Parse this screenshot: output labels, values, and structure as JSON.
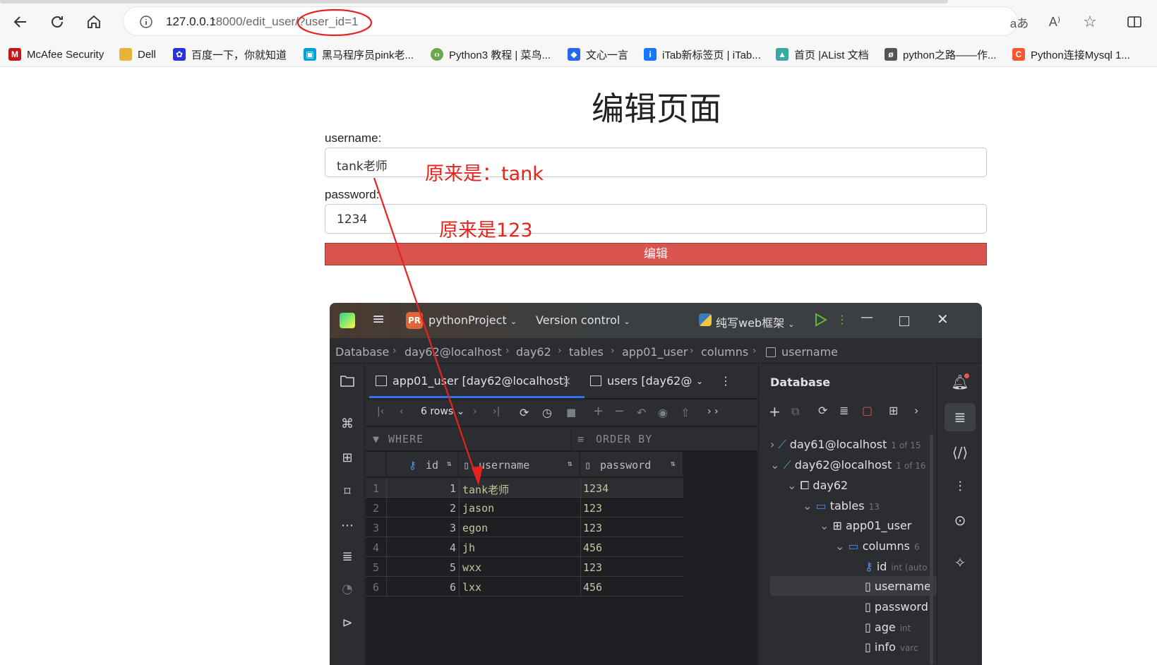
{
  "browser": {
    "url_host": "127.0.0.1",
    "url_path": ":8000/edit_user/?user_id=1",
    "bookmarks": [
      {
        "label": "McAfee Security",
        "icon": "mcafee-icon",
        "color": "#c01818"
      },
      {
        "label": "Dell",
        "icon": "folder-icon",
        "color": "#e8b339"
      },
      {
        "label": "百度一下，你就知道",
        "icon": "baidu-icon",
        "color": "#2932e1"
      },
      {
        "label": "黑马程序员pink老...",
        "icon": "bilibili-icon",
        "color": "#00a1d6"
      },
      {
        "label": "Python3 教程 | 菜鸟...",
        "icon": "runoob-icon",
        "color": "#6aa84f"
      },
      {
        "label": "文心一言",
        "icon": "wenxin-icon",
        "color": "#2468f2"
      },
      {
        "label": "iTab新标签页 | iTab...",
        "icon": "itab-icon",
        "color": "#1677ff"
      },
      {
        "label": "首页 |AList 文档",
        "icon": "alist-icon",
        "color": "#3aa7a3"
      },
      {
        "label": "python之路——作...",
        "icon": "python-road-icon",
        "color": "#555555"
      },
      {
        "label": "Python连接Mysql 1...",
        "icon": "csdn-icon",
        "color": "#fc5531"
      }
    ]
  },
  "form": {
    "title": "编辑页面",
    "username_label": "username:",
    "username_value": "tank老师",
    "password_label": "password:",
    "password_value": "1234",
    "submit_label": "编辑"
  },
  "annotations": {
    "note_username": "原来是：tank",
    "note_password": "原来是123",
    "accent_color": "#e8231f"
  },
  "ide": {
    "project_badge": "PR",
    "project_name": "pythonProject",
    "vcs_label": "Version control",
    "run_config": "纯写web框架",
    "breadcrumbs": [
      "Database",
      "day62@localhost",
      "day62",
      "tables",
      "app01_user",
      "columns",
      "username"
    ],
    "tabs": [
      {
        "label": "app01_user [day62@localhost]"
      },
      {
        "label": "users [day62@"
      }
    ],
    "rows_label": "6 rows",
    "where_label": "WHERE",
    "orderby_label": "ORDER BY",
    "columns": [
      "id",
      "username",
      "password"
    ],
    "rows": [
      {
        "n": "1",
        "id": "1",
        "username": "tank老师",
        "password": "1234"
      },
      {
        "n": "2",
        "id": "2",
        "username": "jason",
        "password": "123"
      },
      {
        "n": "3",
        "id": "3",
        "username": "egon",
        "password": "123"
      },
      {
        "n": "4",
        "id": "4",
        "username": "jh",
        "password": "456"
      },
      {
        "n": "5",
        "id": "5",
        "username": "wxx",
        "password": "123"
      },
      {
        "n": "6",
        "id": "6",
        "username": "lxx",
        "password": "456"
      }
    ],
    "db_panel": {
      "title": "Database",
      "tree": {
        "day61": {
          "label": "day61@localhost",
          "meta": "1 of 15"
        },
        "day62": {
          "label": "day62@localhost",
          "meta": "1 of 16"
        },
        "schema": {
          "label": "day62"
        },
        "tables": {
          "label": "tables",
          "meta": "13"
        },
        "table": {
          "label": "app01_user"
        },
        "columns": {
          "label": "columns",
          "meta": "6"
        },
        "col_id": {
          "label": "id",
          "meta": "int (auto"
        },
        "col_username": {
          "label": "username"
        },
        "col_password": {
          "label": "password"
        },
        "col_age": {
          "label": "age",
          "meta": "int"
        },
        "col_info": {
          "label": "info",
          "meta": "varc"
        }
      }
    }
  }
}
